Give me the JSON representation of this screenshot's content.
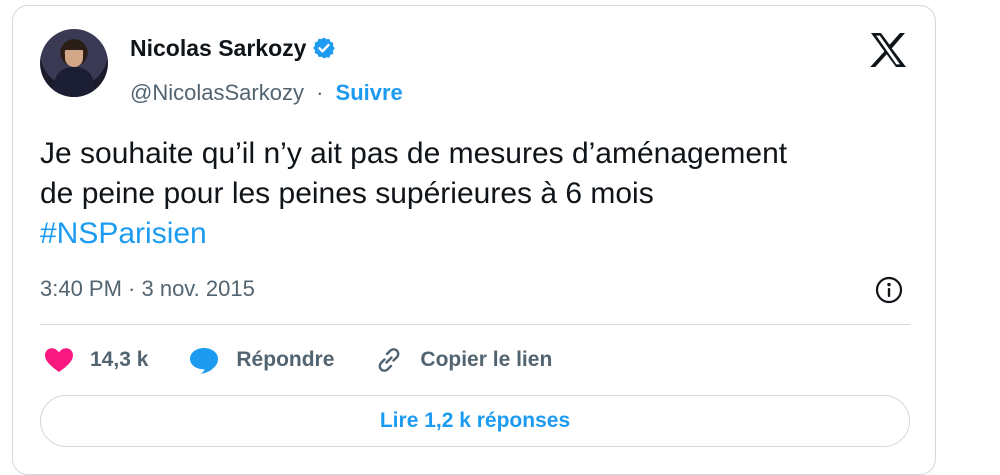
{
  "tweet": {
    "author": {
      "name": "Nicolas Sarkozy",
      "handle": "@NicolasSarkozy",
      "separator": "·",
      "follow_label": "Suivre",
      "verified_color": "#1d9bf0"
    },
    "text_lines": [
      "Je souhaite qu’il n’y ait pas de mesures d’aménagement",
      "de peine pour les peines supérieures à 6 mois"
    ],
    "hashtag": "#NSParisien",
    "timestamp": "3:40 PM · 3 nov. 2015",
    "icons": {
      "logo": "x-logo-icon",
      "info": "info-icon",
      "like": "heart-icon",
      "reply": "speech-bubble-icon",
      "copy": "link-icon"
    }
  },
  "actions": {
    "like_count": "14,3 k",
    "reply_label": "Répondre",
    "copy_label": "Copier le lien"
  },
  "footer": {
    "read_replies_label": "Lire 1,2 k réponses"
  },
  "colors": {
    "accent": "#1d9bf0",
    "like": "#f91880",
    "muted_text": "#536471",
    "border": "#cfd9de"
  }
}
